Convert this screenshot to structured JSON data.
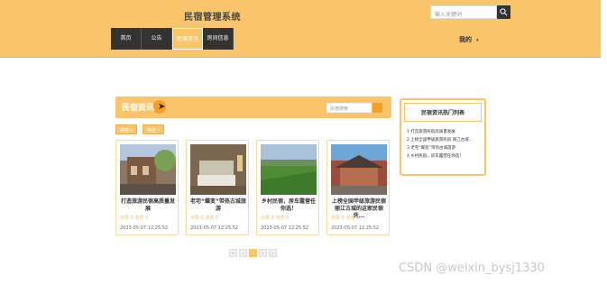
{
  "header": {
    "site_title": "民宿管理系统",
    "search_placeholder": "输入关键词",
    "user_menu": "我的",
    "nav": [
      {
        "label": "首页"
      },
      {
        "label": "公告"
      },
      {
        "label": "民宿资讯"
      },
      {
        "label": "房间信息"
      }
    ]
  },
  "main": {
    "section_title": "民宿资讯",
    "inner_search_placeholder": "民宿搜索",
    "filters": [
      "排序 ▾",
      "筛选 ▾"
    ],
    "cards": [
      {
        "title": "打造旅游民宿高质量发展",
        "meta": "点赞 0  浏览 0",
        "date": "2023-05-07 12:25:52"
      },
      {
        "title": "老宅“蝶变”带热古城旅游",
        "meta": "点赞 0  浏览 0",
        "date": "2023-05-07 12:25:52"
      },
      {
        "title": "乡村民宿，房车露营任你选！",
        "meta": "点赞 0  浏览 0",
        "date": "2023-05-07 12:25:52"
      },
      {
        "title": "上榜全国甲级旅游民宿 丽江古城的这家民宿凭...",
        "meta": "点赞 0  浏览 0",
        "date": "2023-05-07 12:25:52"
      }
    ],
    "pagination": [
      "«",
      "‹",
      "1",
      "›",
      "»"
    ]
  },
  "hot_panel": {
    "title": "民宿资讯热门列表",
    "items": [
      "1  打造旅游民宿高质量发展",
      "2  上榜全国甲级旅游民宿 丽江古城...",
      "3  老宅“蝶变”带热古城旅游",
      "4  乡村民宿，房车露营任你选！"
    ]
  },
  "watermark": "CSDN @weixin_bysj1330"
}
